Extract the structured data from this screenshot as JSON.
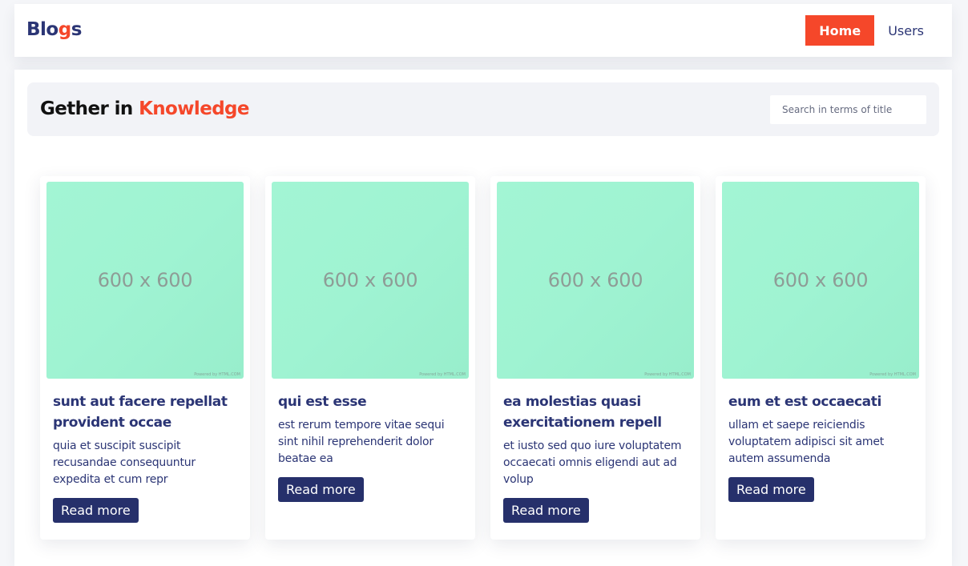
{
  "navbar": {
    "logo_prefix": "Blo",
    "logo_accent": "g",
    "logo_suffix": "s",
    "links": [
      {
        "label": "Home",
        "active": true
      },
      {
        "label": "Users",
        "active": false
      }
    ]
  },
  "hero": {
    "title_prefix": "Gether in ",
    "title_accent": "Knowledge",
    "search_placeholder": "Search in terms of title"
  },
  "colors": {
    "accent": "#f5472a",
    "primary": "#26306b",
    "thumbnail": "#a1f5d3"
  },
  "cards": [
    {
      "image_label": "600 x 600",
      "image_credit": "Powered by HTML.COM",
      "title": "sunt aut facere repellat provident occae",
      "body": "quia et suscipit suscipit recusandae consequuntur expedita et cum repr",
      "button_label": "Read more"
    },
    {
      "image_label": "600 x 600",
      "image_credit": "Powered by HTML.COM",
      "title": "qui est esse",
      "body": "est rerum tempore vitae sequi sint nihil reprehenderit dolor beatae ea",
      "button_label": "Read more"
    },
    {
      "image_label": "600 x 600",
      "image_credit": "Powered by HTML.COM",
      "title": "ea molestias quasi exercitationem repell",
      "body": "et iusto sed quo iure voluptatem occaecati omnis eligendi aut ad volup",
      "button_label": "Read more"
    },
    {
      "image_label": "600 x 600",
      "image_credit": "Powered by HTML.COM",
      "title": "eum et est occaecati",
      "body": "ullam et saepe reiciendis voluptatem adipisci sit amet autem assumenda",
      "button_label": "Read more"
    }
  ]
}
